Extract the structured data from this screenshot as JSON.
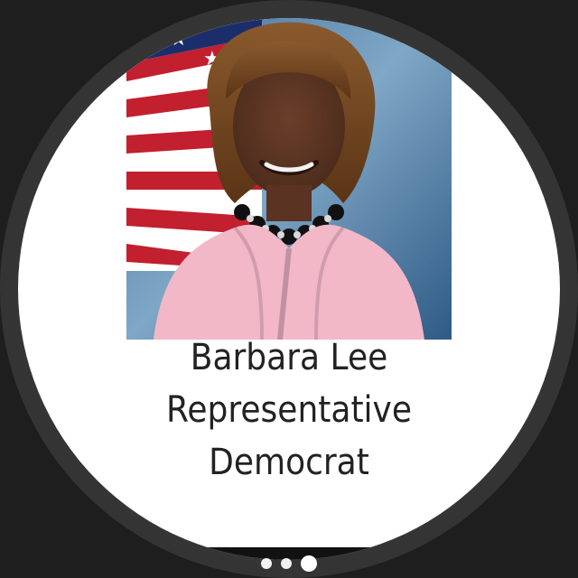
{
  "member": {
    "name": "Barbara Lee",
    "title": "Representative",
    "party": "Democrat",
    "photo_alt": "Barbara Lee portrait"
  },
  "pager": {
    "dots": [
      {
        "active": false
      },
      {
        "active": false
      },
      {
        "active": true
      }
    ]
  }
}
